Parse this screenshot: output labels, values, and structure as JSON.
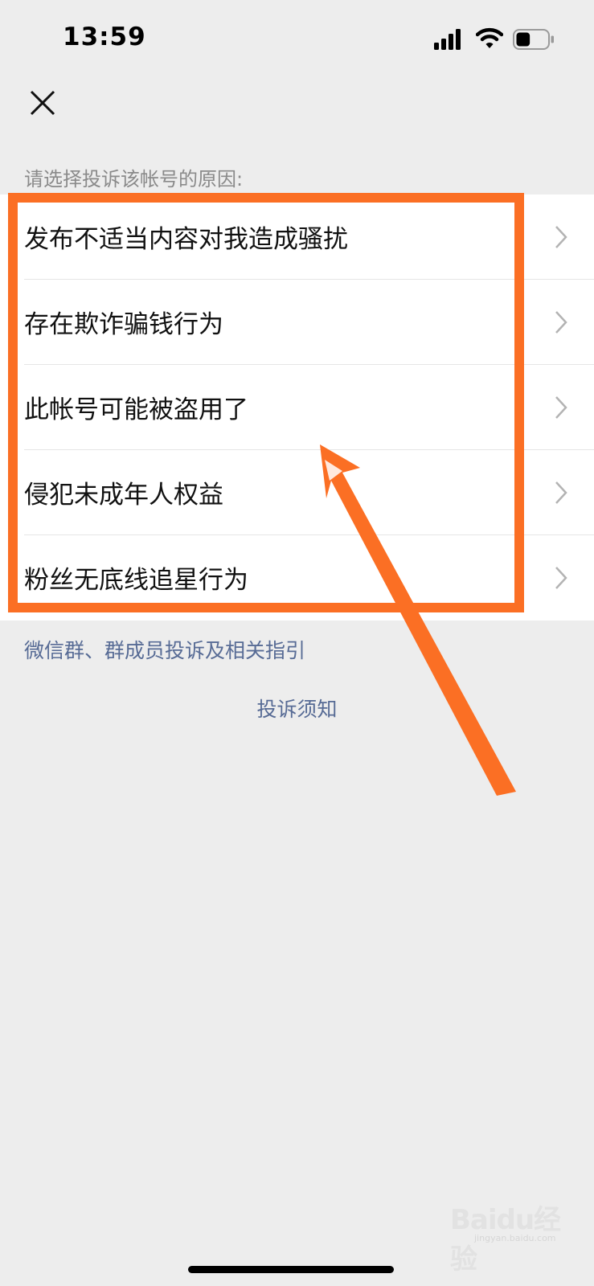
{
  "status_bar": {
    "time": "13:59",
    "battery_level": 0.45
  },
  "header": {
    "close_icon": "close-icon"
  },
  "prompt": "请选择投诉该帐号的原因:",
  "reasons": [
    {
      "label": "发布不适当内容对我造成骚扰"
    },
    {
      "label": "存在欺诈骗钱行为"
    },
    {
      "label": "此帐号可能被盗用了"
    },
    {
      "label": "侵犯未成年人权益"
    },
    {
      "label": "粉丝无底线追星行为"
    }
  ],
  "links": {
    "group_guide": "微信群、群成员投诉及相关指引",
    "notice": "投诉须知"
  },
  "watermark": {
    "brand": "Baidu经验",
    "sub": "jingyan.baidu.com"
  },
  "colors": {
    "background": "#ededed",
    "link": "#576b95",
    "annotation": "#fb6f24"
  }
}
